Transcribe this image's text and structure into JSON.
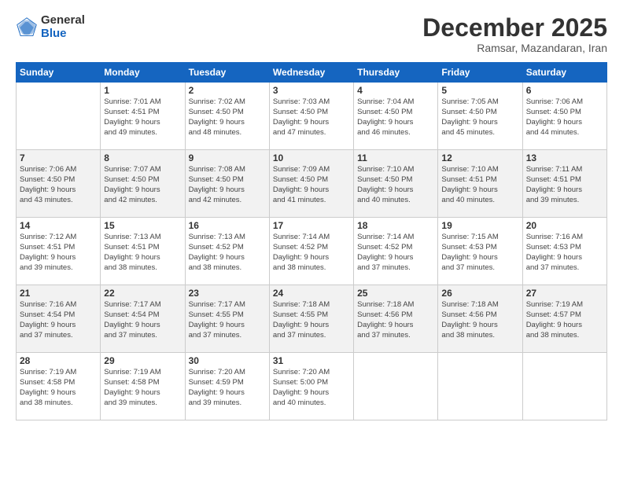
{
  "logo": {
    "general": "General",
    "blue": "Blue"
  },
  "title": "December 2025",
  "subtitle": "Ramsar, Mazandaran, Iran",
  "days_of_week": [
    "Sunday",
    "Monday",
    "Tuesday",
    "Wednesday",
    "Thursday",
    "Friday",
    "Saturday"
  ],
  "weeks": [
    [
      {
        "day": "",
        "info": ""
      },
      {
        "day": "1",
        "info": "Sunrise: 7:01 AM\nSunset: 4:51 PM\nDaylight: 9 hours\nand 49 minutes."
      },
      {
        "day": "2",
        "info": "Sunrise: 7:02 AM\nSunset: 4:50 PM\nDaylight: 9 hours\nand 48 minutes."
      },
      {
        "day": "3",
        "info": "Sunrise: 7:03 AM\nSunset: 4:50 PM\nDaylight: 9 hours\nand 47 minutes."
      },
      {
        "day": "4",
        "info": "Sunrise: 7:04 AM\nSunset: 4:50 PM\nDaylight: 9 hours\nand 46 minutes."
      },
      {
        "day": "5",
        "info": "Sunrise: 7:05 AM\nSunset: 4:50 PM\nDaylight: 9 hours\nand 45 minutes."
      },
      {
        "day": "6",
        "info": "Sunrise: 7:06 AM\nSunset: 4:50 PM\nDaylight: 9 hours\nand 44 minutes."
      }
    ],
    [
      {
        "day": "7",
        "info": "Sunrise: 7:06 AM\nSunset: 4:50 PM\nDaylight: 9 hours\nand 43 minutes."
      },
      {
        "day": "8",
        "info": "Sunrise: 7:07 AM\nSunset: 4:50 PM\nDaylight: 9 hours\nand 42 minutes."
      },
      {
        "day": "9",
        "info": "Sunrise: 7:08 AM\nSunset: 4:50 PM\nDaylight: 9 hours\nand 42 minutes."
      },
      {
        "day": "10",
        "info": "Sunrise: 7:09 AM\nSunset: 4:50 PM\nDaylight: 9 hours\nand 41 minutes."
      },
      {
        "day": "11",
        "info": "Sunrise: 7:10 AM\nSunset: 4:50 PM\nDaylight: 9 hours\nand 40 minutes."
      },
      {
        "day": "12",
        "info": "Sunrise: 7:10 AM\nSunset: 4:51 PM\nDaylight: 9 hours\nand 40 minutes."
      },
      {
        "day": "13",
        "info": "Sunrise: 7:11 AM\nSunset: 4:51 PM\nDaylight: 9 hours\nand 39 minutes."
      }
    ],
    [
      {
        "day": "14",
        "info": "Sunrise: 7:12 AM\nSunset: 4:51 PM\nDaylight: 9 hours\nand 39 minutes."
      },
      {
        "day": "15",
        "info": "Sunrise: 7:13 AM\nSunset: 4:51 PM\nDaylight: 9 hours\nand 38 minutes."
      },
      {
        "day": "16",
        "info": "Sunrise: 7:13 AM\nSunset: 4:52 PM\nDaylight: 9 hours\nand 38 minutes."
      },
      {
        "day": "17",
        "info": "Sunrise: 7:14 AM\nSunset: 4:52 PM\nDaylight: 9 hours\nand 38 minutes."
      },
      {
        "day": "18",
        "info": "Sunrise: 7:14 AM\nSunset: 4:52 PM\nDaylight: 9 hours\nand 37 minutes."
      },
      {
        "day": "19",
        "info": "Sunrise: 7:15 AM\nSunset: 4:53 PM\nDaylight: 9 hours\nand 37 minutes."
      },
      {
        "day": "20",
        "info": "Sunrise: 7:16 AM\nSunset: 4:53 PM\nDaylight: 9 hours\nand 37 minutes."
      }
    ],
    [
      {
        "day": "21",
        "info": "Sunrise: 7:16 AM\nSunset: 4:54 PM\nDaylight: 9 hours\nand 37 minutes."
      },
      {
        "day": "22",
        "info": "Sunrise: 7:17 AM\nSunset: 4:54 PM\nDaylight: 9 hours\nand 37 minutes."
      },
      {
        "day": "23",
        "info": "Sunrise: 7:17 AM\nSunset: 4:55 PM\nDaylight: 9 hours\nand 37 minutes."
      },
      {
        "day": "24",
        "info": "Sunrise: 7:18 AM\nSunset: 4:55 PM\nDaylight: 9 hours\nand 37 minutes."
      },
      {
        "day": "25",
        "info": "Sunrise: 7:18 AM\nSunset: 4:56 PM\nDaylight: 9 hours\nand 37 minutes."
      },
      {
        "day": "26",
        "info": "Sunrise: 7:18 AM\nSunset: 4:56 PM\nDaylight: 9 hours\nand 38 minutes."
      },
      {
        "day": "27",
        "info": "Sunrise: 7:19 AM\nSunset: 4:57 PM\nDaylight: 9 hours\nand 38 minutes."
      }
    ],
    [
      {
        "day": "28",
        "info": "Sunrise: 7:19 AM\nSunset: 4:58 PM\nDaylight: 9 hours\nand 38 minutes."
      },
      {
        "day": "29",
        "info": "Sunrise: 7:19 AM\nSunset: 4:58 PM\nDaylight: 9 hours\nand 39 minutes."
      },
      {
        "day": "30",
        "info": "Sunrise: 7:20 AM\nSunset: 4:59 PM\nDaylight: 9 hours\nand 39 minutes."
      },
      {
        "day": "31",
        "info": "Sunrise: 7:20 AM\nSunset: 5:00 PM\nDaylight: 9 hours\nand 40 minutes."
      },
      {
        "day": "",
        "info": ""
      },
      {
        "day": "",
        "info": ""
      },
      {
        "day": "",
        "info": ""
      }
    ]
  ]
}
